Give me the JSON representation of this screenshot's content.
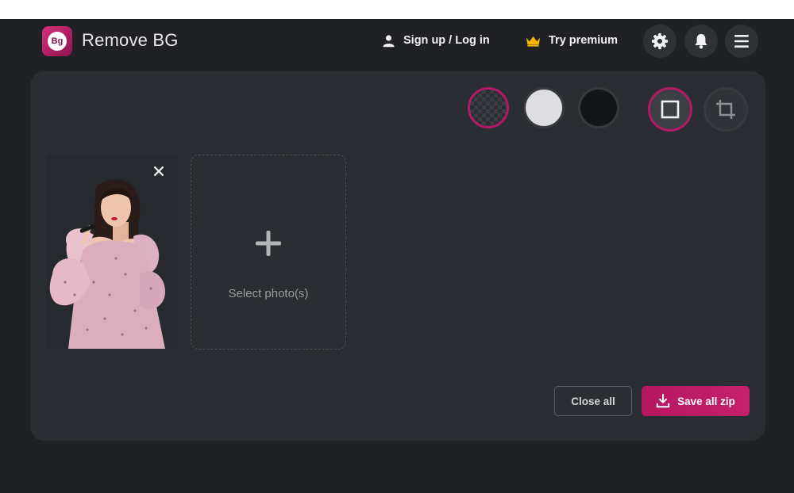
{
  "header": {
    "app_title": "Remove BG",
    "logo_text": "Bg",
    "auth_link": "Sign up / Log in",
    "premium_link": "Try premium",
    "icons": [
      "user-icon",
      "crown-icon",
      "gear-icon",
      "bell-icon",
      "menu-icon"
    ]
  },
  "toolbar": {
    "backgrounds": [
      "transparent",
      "white",
      "black"
    ],
    "selected_background": "transparent",
    "tools": [
      "square-icon",
      "crop-icon"
    ],
    "selected_tool": "square"
  },
  "uploads": {
    "dropzone_label": "Select photo(s)"
  },
  "actions": {
    "close_all": "Close all",
    "save_all_zip": "Save all zip"
  },
  "colors": {
    "accent": "#b6175f",
    "background": "#1f2124",
    "panel": "#2a2d31",
    "premium_gold": "#f5b400"
  }
}
